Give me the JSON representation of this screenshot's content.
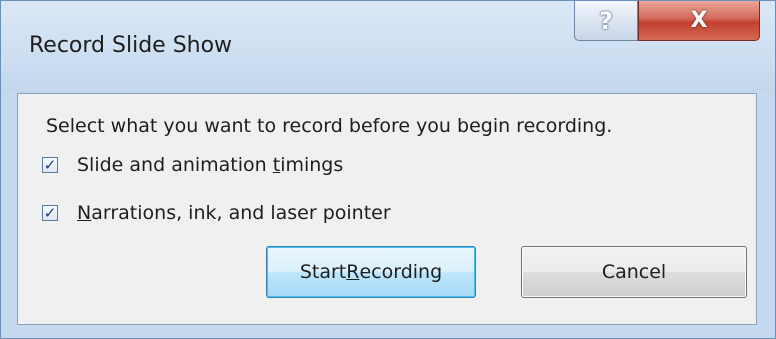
{
  "window": {
    "title": "Record Slide Show",
    "help_glyph": "?",
    "close_glyph": "X"
  },
  "dialog": {
    "instruction": "Select what you want to record before you begin recording.",
    "options": [
      {
        "pre": "Slide and animation ",
        "accel": "t",
        "post": "imings",
        "checked": true
      },
      {
        "pre": "",
        "accel": "N",
        "post": "arrations, ink, and laser pointer",
        "checked": true
      }
    ],
    "check_mark": "✓"
  },
  "buttons": {
    "start": {
      "pre": "Start ",
      "accel": "R",
      "post": "ecording"
    },
    "cancel": "Cancel"
  },
  "icons": {
    "help": "help-icon",
    "close": "close-icon",
    "check": "checkmark-icon"
  },
  "colors": {
    "close_button": "#c2402e",
    "default_button_border": "#3c7fb1",
    "client_background": "#f0f0f0",
    "frame": "#c5d9ef"
  }
}
